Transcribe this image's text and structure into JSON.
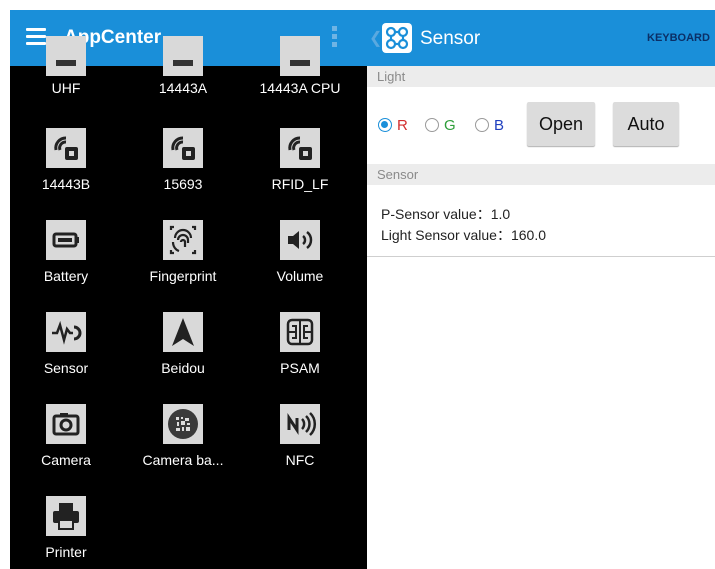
{
  "left": {
    "title": "AppCenter",
    "apps": [
      {
        "label": "UHF",
        "icon": "uhf-icon"
      },
      {
        "label": "14443A",
        "icon": "14443a-icon"
      },
      {
        "label": "14443A CPU",
        "icon": "14443a-cpu-icon"
      },
      {
        "label": "14443B",
        "icon": "card-reader-icon"
      },
      {
        "label": "15693",
        "icon": "card-reader-icon"
      },
      {
        "label": "RFID_LF",
        "icon": "card-reader-icon"
      },
      {
        "label": "Battery",
        "icon": "battery-icon"
      },
      {
        "label": "Fingerprint",
        "icon": "fingerprint-icon"
      },
      {
        "label": "Volume",
        "icon": "volume-icon"
      },
      {
        "label": "Sensor",
        "icon": "sensor-icon"
      },
      {
        "label": "Beidou",
        "icon": "navigation-arrow-icon"
      },
      {
        "label": "PSAM",
        "icon": "psam-chip-icon"
      },
      {
        "label": "Camera",
        "icon": "camera-icon"
      },
      {
        "label": "Camera ba...",
        "icon": "barcode-scan-icon"
      },
      {
        "label": "NFC",
        "icon": "nfc-icon"
      },
      {
        "label": "Printer",
        "icon": "printer-icon"
      }
    ]
  },
  "right": {
    "title": "Sensor",
    "keyboard_label": "KEYBOARD",
    "light": {
      "header": "Light",
      "options": [
        {
          "label": "R",
          "color": "#d32f2f",
          "selected": true
        },
        {
          "label": "G",
          "color": "#2e9e3a",
          "selected": false
        },
        {
          "label": "B",
          "color": "#1f3fbf",
          "selected": false
        }
      ],
      "open_label": "Open",
      "auto_label": "Auto"
    },
    "sensor": {
      "header": "Sensor",
      "p_sensor": "P-Sensor value：1.0",
      "light_sensor": "Light Sensor value：160.0"
    }
  },
  "colors": {
    "accent": "#1a8fd9",
    "tile": "#d9d9d9",
    "background_left": "#000000"
  }
}
